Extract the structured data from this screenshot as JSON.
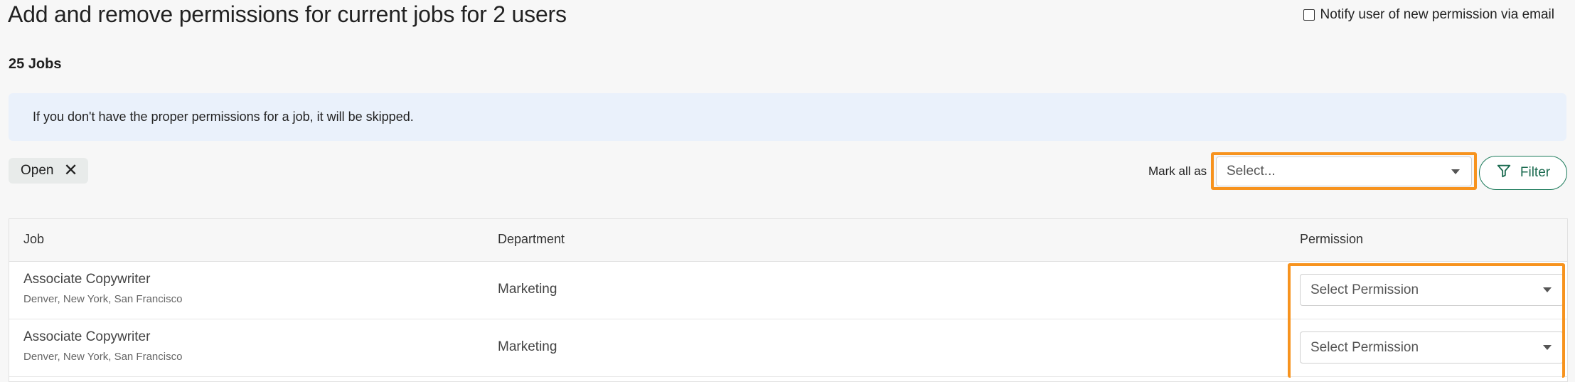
{
  "header": {
    "title": "Add and remove permissions for current jobs for 2 users",
    "notify_label": "Notify user of new permission via email",
    "notify_checked": false
  },
  "jobs_count": "25 Jobs",
  "banner": {
    "text": "If you don't have the proper permissions for a job, it will be skipped."
  },
  "filters": {
    "chip_label": "Open",
    "mark_all_label": "Mark all as",
    "mark_all_placeholder": "Select...",
    "filter_button_label": "Filter"
  },
  "table": {
    "columns": {
      "job": "Job",
      "department": "Department",
      "permission": "Permission"
    },
    "rows": [
      {
        "job": "Associate Copywriter",
        "locations": "Denver, New York, San Francisco",
        "department": "Marketing",
        "permission": "Select Permission"
      },
      {
        "job": "Associate Copywriter",
        "locations": "Denver, New York, San Francisco",
        "department": "Marketing",
        "permission": "Select Permission"
      }
    ]
  },
  "colors": {
    "highlight": "#f7931e",
    "accent": "#1b7a5a",
    "banner_bg": "#eaf1fb"
  },
  "icons": [
    "close-icon",
    "chevron-down-icon",
    "filter-icon"
  ]
}
